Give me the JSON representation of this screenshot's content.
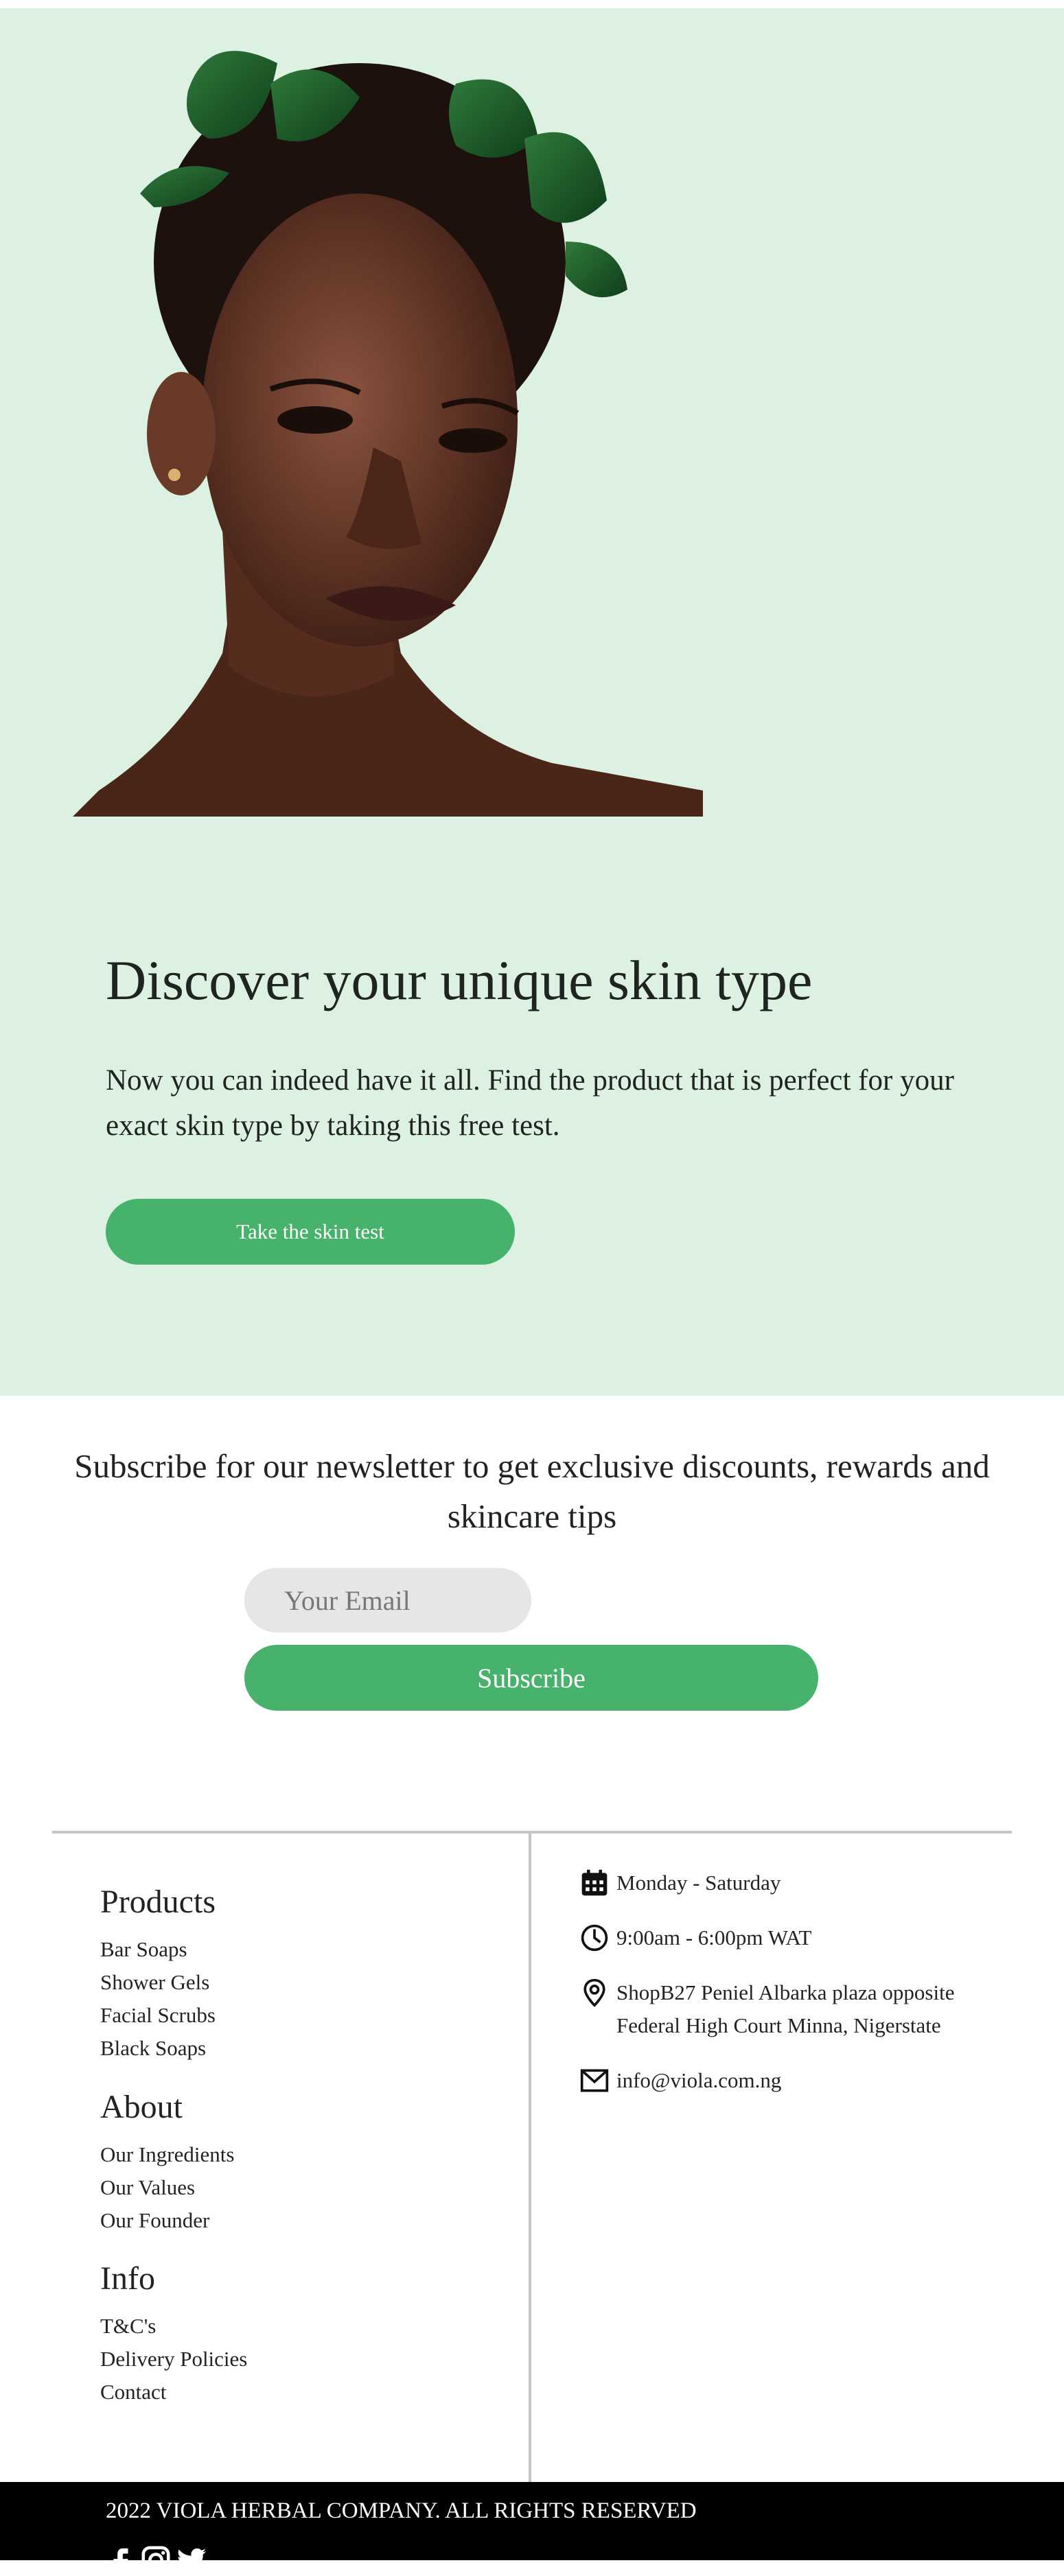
{
  "hero": {
    "title": "Discover your unique skin type",
    "subtitle": "Now you can indeed have it all. Find the product that is perfect for your exact skin type by taking this free test.",
    "cta_label": "Take the skin test",
    "background_color": "#dcf1e2",
    "accent_color": "#47b26b"
  },
  "newsletter": {
    "title": "Subscribe for our newsletter to get exclusive discounts, rewards and skincare tips",
    "email_placeholder": "Your Email",
    "subscribe_label": "Subscribe"
  },
  "footer": {
    "sections": [
      {
        "heading": "Products",
        "links": [
          "Bar Soaps",
          "Shower Gels",
          "Facial Scrubs",
          "Black Soaps"
        ]
      },
      {
        "heading": "About",
        "links": [
          "Our Ingredients",
          "Our Values",
          "Our Founder"
        ]
      },
      {
        "heading": "Info",
        "links": [
          "T&C's",
          "Delivery Policies",
          "Contact"
        ]
      }
    ],
    "contact": {
      "days": "Monday - Saturday",
      "hours": "9:00am - 6:00pm WAT",
      "address_line1": "ShopB27 Peniel Albarka plaza opposite",
      "address_line2": "Federal High Court Minna, Nigerstate",
      "email": "info@viola.com.ng",
      "icons": [
        "calendar-icon",
        "clock-icon",
        "location-pin-icon",
        "envelope-icon"
      ]
    },
    "copyright": "2022 VIOLA HERBAL COMPANY. ALL RIGHTS RESERVED",
    "social": [
      "facebook-icon",
      "instagram-icon",
      "twitter-icon"
    ]
  }
}
